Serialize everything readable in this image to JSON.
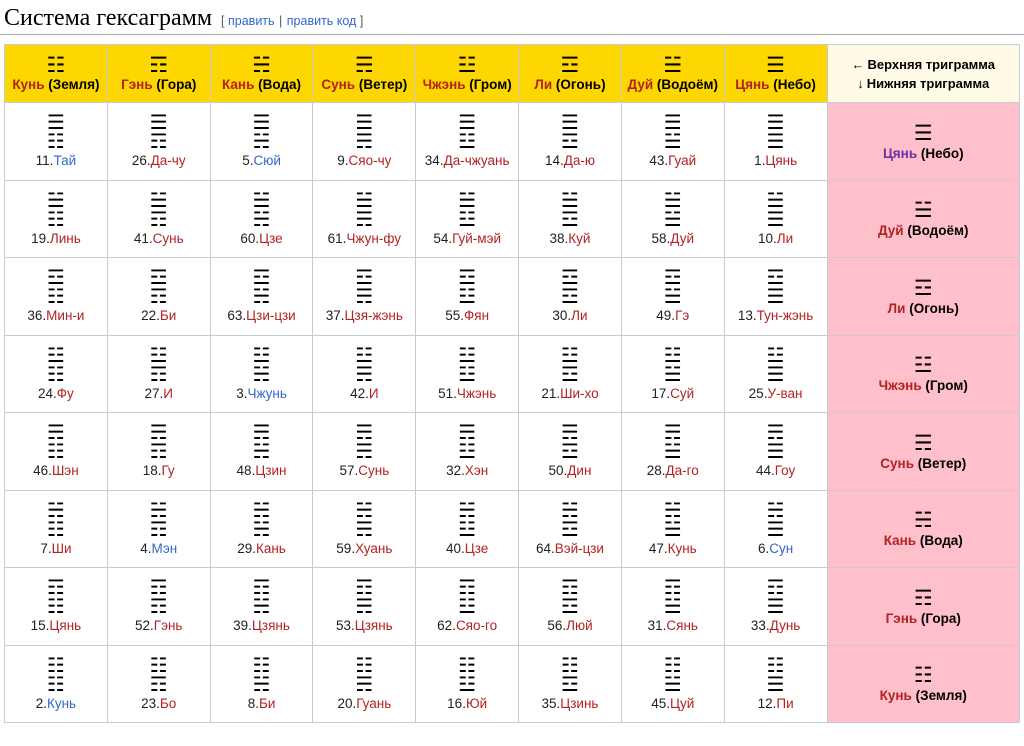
{
  "header": {
    "title": "Система гексаграмм",
    "edit": {
      "open_bracket": "[",
      "edit_label": "править",
      "separator": "|",
      "edit_source_label": "править код",
      "close_bracket": "]"
    }
  },
  "legend_header": {
    "upper_arrow": "←",
    "upper_text": "Верхняя триграмма",
    "lower_arrow": "↓",
    "lower_text": "Нижняя триграмма"
  },
  "colors": {
    "header_bg": "#ffd700",
    "legend_bg": "#ffc0cb",
    "legend_head_bg": "#fffbe6",
    "link_red": "#b22222",
    "link_blue": "#3366cc",
    "link_purple": "#6b2fa0",
    "border": "#c8ccd1"
  },
  "columns": [
    {
      "trigram": "☷",
      "name": "Кунь",
      "element": "(Земля)"
    },
    {
      "trigram": "☶",
      "name": "Гэнь",
      "element": "(Гора)"
    },
    {
      "trigram": "☵",
      "name": "Кань",
      "element": "(Вода)"
    },
    {
      "trigram": "☴",
      "name": "Сунь",
      "element": "(Ветер)"
    },
    {
      "trigram": "☳",
      "name": "Чжэнь",
      "element": "(Гром)"
    },
    {
      "trigram": "☲",
      "name": "Ли",
      "element": "(Огонь)"
    },
    {
      "trigram": "☱",
      "name": "Дуй",
      "element": "(Водоём)"
    },
    {
      "trigram": "☰",
      "name": "Цянь",
      "element": "(Небо)"
    }
  ],
  "rows": [
    {
      "legend": {
        "trigram": "☰",
        "name": "Цянь",
        "element": "(Небо)",
        "link": "purple"
      },
      "cells": [
        {
          "upper": "☰",
          "lower": "☷",
          "num": "11.",
          "name": "Тай",
          "link": "blue"
        },
        {
          "upper": "☰",
          "lower": "☶",
          "num": "26.",
          "name": "Да-чу",
          "link": "red"
        },
        {
          "upper": "☰",
          "lower": "☵",
          "num": "5.",
          "name": "Сюй",
          "link": "blue"
        },
        {
          "upper": "☰",
          "lower": "☴",
          "num": "9.",
          "name": "Сяо-чу",
          "link": "red"
        },
        {
          "upper": "☰",
          "lower": "☳",
          "num": "34.",
          "name": "Да-чжуань",
          "link": "red"
        },
        {
          "upper": "☰",
          "lower": "☲",
          "num": "14.",
          "name": "Да-ю",
          "link": "red"
        },
        {
          "upper": "☰",
          "lower": "☱",
          "num": "43.",
          "name": "Гуай",
          "link": "red"
        },
        {
          "upper": "☰",
          "lower": "☰",
          "num": "1.",
          "name": "Цянь",
          "link": "red"
        }
      ]
    },
    {
      "legend": {
        "trigram": "☱",
        "name": "Дуй",
        "element": "(Водоём)",
        "link": "red"
      },
      "cells": [
        {
          "upper": "☱",
          "lower": "☷",
          "num": "19.",
          "name": "Линь",
          "link": "red"
        },
        {
          "upper": "☱",
          "lower": "☶",
          "num": "41.",
          "name": "Сунь",
          "link": "red"
        },
        {
          "upper": "☱",
          "lower": "☵",
          "num": "60.",
          "name": "Цзе",
          "link": "red"
        },
        {
          "upper": "☱",
          "lower": "☴",
          "num": "61.",
          "name": "Чжун-фу",
          "link": "red"
        },
        {
          "upper": "☱",
          "lower": "☳",
          "num": "54.",
          "name": "Гуй-мэй",
          "link": "red"
        },
        {
          "upper": "☱",
          "lower": "☲",
          "num": "38.",
          "name": "Куй",
          "link": "red"
        },
        {
          "upper": "☱",
          "lower": "☱",
          "num": "58.",
          "name": "Дуй",
          "link": "red"
        },
        {
          "upper": "☱",
          "lower": "☰",
          "num": "10.",
          "name": "Ли",
          "link": "red"
        }
      ]
    },
    {
      "legend": {
        "trigram": "☲",
        "name": "Ли",
        "element": "(Огонь)",
        "link": "red"
      },
      "cells": [
        {
          "upper": "☲",
          "lower": "☷",
          "num": "36.",
          "name": "Мин-и",
          "link": "red"
        },
        {
          "upper": "☲",
          "lower": "☶",
          "num": "22.",
          "name": "Би",
          "link": "red"
        },
        {
          "upper": "☲",
          "lower": "☵",
          "num": "63.",
          "name": "Цзи-цзи",
          "link": "red"
        },
        {
          "upper": "☲",
          "lower": "☴",
          "num": "37.",
          "name": "Цзя-жэнь",
          "link": "red"
        },
        {
          "upper": "☲",
          "lower": "☳",
          "num": "55.",
          "name": "Фян",
          "link": "red"
        },
        {
          "upper": "☲",
          "lower": "☲",
          "num": "30.",
          "name": "Ли",
          "link": "red"
        },
        {
          "upper": "☲",
          "lower": "☱",
          "num": "49.",
          "name": "Гэ",
          "link": "red"
        },
        {
          "upper": "☲",
          "lower": "☰",
          "num": "13.",
          "name": "Тун-жэнь",
          "link": "red"
        }
      ]
    },
    {
      "legend": {
        "trigram": "☳",
        "name": "Чжэнь",
        "element": "(Гром)",
        "link": "red"
      },
      "cells": [
        {
          "upper": "☳",
          "lower": "☷",
          "num": "24.",
          "name": "Фу",
          "link": "red"
        },
        {
          "upper": "☳",
          "lower": "☶",
          "num": "27.",
          "name": "И",
          "link": "red"
        },
        {
          "upper": "☳",
          "lower": "☵",
          "num": "3.",
          "name": "Чжунь",
          "link": "blue"
        },
        {
          "upper": "☳",
          "lower": "☴",
          "num": "42.",
          "name": "И",
          "link": "red"
        },
        {
          "upper": "☳",
          "lower": "☳",
          "num": "51.",
          "name": "Чжэнь",
          "link": "red"
        },
        {
          "upper": "☳",
          "lower": "☲",
          "num": "21.",
          "name": "Ши-хо",
          "link": "red"
        },
        {
          "upper": "☳",
          "lower": "☱",
          "num": "17.",
          "name": "Суй",
          "link": "red"
        },
        {
          "upper": "☳",
          "lower": "☰",
          "num": "25.",
          "name": "У-ван",
          "link": "red"
        }
      ]
    },
    {
      "legend": {
        "trigram": "☴",
        "name": "Сунь",
        "element": "(Ветер)",
        "link": "red"
      },
      "cells": [
        {
          "upper": "☴",
          "lower": "☷",
          "num": "46.",
          "name": "Шэн",
          "link": "red"
        },
        {
          "upper": "☴",
          "lower": "☶",
          "num": "18.",
          "name": "Гу",
          "link": "red"
        },
        {
          "upper": "☴",
          "lower": "☵",
          "num": "48.",
          "name": "Цзин",
          "link": "red"
        },
        {
          "upper": "☴",
          "lower": "☴",
          "num": "57.",
          "name": "Сунь",
          "link": "red"
        },
        {
          "upper": "☴",
          "lower": "☳",
          "num": "32.",
          "name": "Хэн",
          "link": "red"
        },
        {
          "upper": "☴",
          "lower": "☲",
          "num": "50.",
          "name": "Дин",
          "link": "red"
        },
        {
          "upper": "☴",
          "lower": "☱",
          "num": "28.",
          "name": "Да-го",
          "link": "red"
        },
        {
          "upper": "☴",
          "lower": "☰",
          "num": "44.",
          "name": "Гоу",
          "link": "red"
        }
      ]
    },
    {
      "legend": {
        "trigram": "☵",
        "name": "Кань",
        "element": "(Вода)",
        "link": "red"
      },
      "cells": [
        {
          "upper": "☵",
          "lower": "☷",
          "num": "7.",
          "name": "Ши",
          "link": "red"
        },
        {
          "upper": "☵",
          "lower": "☶",
          "num": "4.",
          "name": "Мэн",
          "link": "blue"
        },
        {
          "upper": "☵",
          "lower": "☵",
          "num": "29.",
          "name": "Кань",
          "link": "red"
        },
        {
          "upper": "☵",
          "lower": "☴",
          "num": "59.",
          "name": "Хуань",
          "link": "red"
        },
        {
          "upper": "☵",
          "lower": "☳",
          "num": "40.",
          "name": "Цзе",
          "link": "red"
        },
        {
          "upper": "☵",
          "lower": "☲",
          "num": "64.",
          "name": "Вэй-цзи",
          "link": "red"
        },
        {
          "upper": "☵",
          "lower": "☱",
          "num": "47.",
          "name": "Кунь",
          "link": "red"
        },
        {
          "upper": "☵",
          "lower": "☰",
          "num": "6.",
          "name": "Сун",
          "link": "blue"
        }
      ]
    },
    {
      "legend": {
        "trigram": "☶",
        "name": "Гэнь",
        "element": "(Гора)",
        "link": "red"
      },
      "cells": [
        {
          "upper": "☶",
          "lower": "☷",
          "num": "15.",
          "name": "Цянь",
          "link": "red"
        },
        {
          "upper": "☶",
          "lower": "☶",
          "num": "52.",
          "name": "Гэнь",
          "link": "red"
        },
        {
          "upper": "☶",
          "lower": "☵",
          "num": "39.",
          "name": "Цзянь",
          "link": "red"
        },
        {
          "upper": "☶",
          "lower": "☴",
          "num": "53.",
          "name": "Цзянь",
          "link": "red"
        },
        {
          "upper": "☶",
          "lower": "☳",
          "num": "62.",
          "name": "Сяо-го",
          "link": "red"
        },
        {
          "upper": "☶",
          "lower": "☲",
          "num": "56.",
          "name": "Люй",
          "link": "red"
        },
        {
          "upper": "☶",
          "lower": "☱",
          "num": "31.",
          "name": "Сянь",
          "link": "red"
        },
        {
          "upper": "☶",
          "lower": "☰",
          "num": "33.",
          "name": "Дунь",
          "link": "red"
        }
      ]
    },
    {
      "legend": {
        "trigram": "☷",
        "name": "Кунь",
        "element": "(Земля)",
        "link": "red"
      },
      "cells": [
        {
          "upper": "☷",
          "lower": "☷",
          "num": "2.",
          "name": "Кунь",
          "link": "blue"
        },
        {
          "upper": "☷",
          "lower": "☶",
          "num": "23.",
          "name": "Бо",
          "link": "red"
        },
        {
          "upper": "☷",
          "lower": "☵",
          "num": "8.",
          "name": "Би",
          "link": "red"
        },
        {
          "upper": "☷",
          "lower": "☴",
          "num": "20.",
          "name": "Гуань",
          "link": "red"
        },
        {
          "upper": "☷",
          "lower": "☳",
          "num": "16.",
          "name": "Юй",
          "link": "red"
        },
        {
          "upper": "☷",
          "lower": "☲",
          "num": "35.",
          "name": "Цзинь",
          "link": "red"
        },
        {
          "upper": "☷",
          "lower": "☱",
          "num": "45.",
          "name": "Цуй",
          "link": "red"
        },
        {
          "upper": "☷",
          "lower": "☰",
          "num": "12.",
          "name": "Пи",
          "link": "red"
        }
      ]
    }
  ]
}
